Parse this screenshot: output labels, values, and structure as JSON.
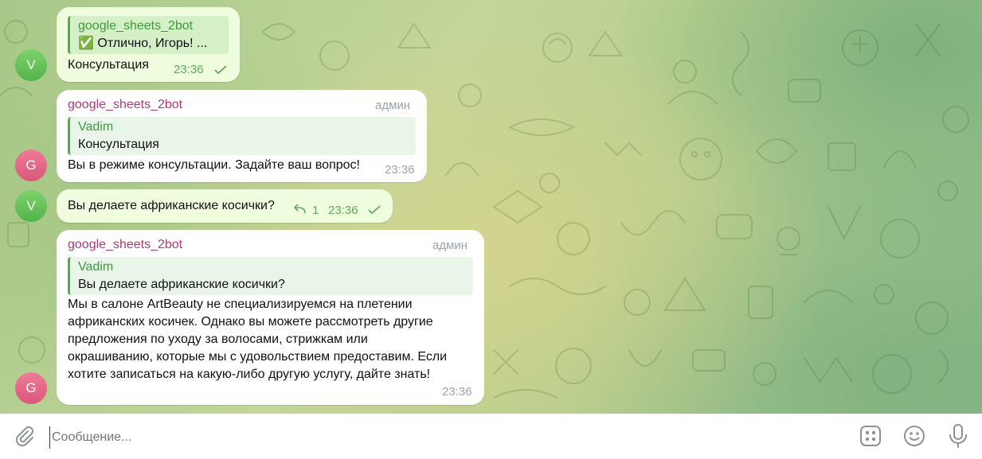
{
  "messages": [
    {
      "avatar_letter": "V",
      "reply_name": "google_sheets_2bot",
      "reply_text": "✅ Отлично, Игорь! ...",
      "text": "Консультация",
      "time": "23:36"
    },
    {
      "avatar_letter": "G",
      "sender": "google_sheets_2bot",
      "role": "админ",
      "reply_name": "Vadim",
      "reply_text": "Консультация",
      "text": "Вы в режиме консультации. Задайте ваш вопрос!",
      "time": "23:36"
    },
    {
      "avatar_letter": "V",
      "text": "Вы делаете африканские косички?",
      "reply_count": "1",
      "time": "23:36"
    },
    {
      "avatar_letter": "G",
      "sender": "google_sheets_2bot",
      "role": "админ",
      "reply_name": "Vadim",
      "reply_text": "Вы делаете африканские косички?",
      "lines": [
        "Мы в салоне ArtBeauty не специализируемся на плетении",
        "африканских косичек. Однако вы можете рассмотреть другие",
        "предложения по уходу за волосами, стрижкам или",
        "окрашиванию, которые мы с удовольствием предоставим. Если",
        "хотите записаться на какую-либо другую услугу, дайте знать!"
      ],
      "time": "23:36"
    }
  ],
  "composer": {
    "placeholder": "Сообщение...",
    "icons": [
      "paperclip-icon",
      "bot-commands-icon",
      "emoji-icon",
      "microphone-icon"
    ]
  },
  "colors": {
    "outgoing_bubble": "#effdde",
    "incoming_bubble": "#ffffff",
    "accent_green": "#4fae4e",
    "sender_color": "#a83a7d"
  }
}
